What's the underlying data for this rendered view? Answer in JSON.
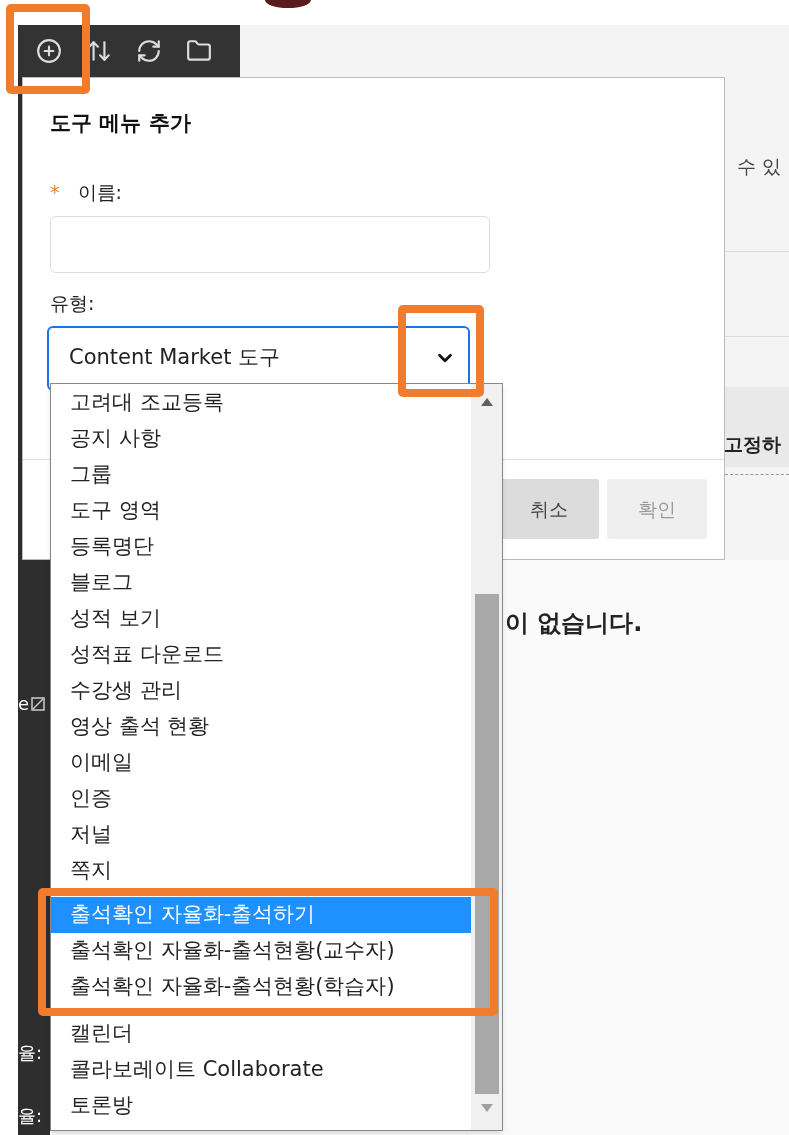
{
  "toolbar": {
    "icons": [
      {
        "kind": "add"
      },
      {
        "kind": "sort"
      },
      {
        "kind": "refresh"
      },
      {
        "kind": "folder"
      }
    ]
  },
  "background": {
    "sidebar_fragments": [
      {
        "text": "e",
        "kind": "image"
      },
      {
        "text": "율:",
        "kind": "plain"
      },
      {
        "text": "율:",
        "kind": "plain"
      }
    ],
    "right_text_1": "수 있",
    "right_text_2": "고정하",
    "message": "이 없습니다."
  },
  "dialog": {
    "title": "도구 메뉴 추가",
    "name_field": {
      "required_mark": "*",
      "label": "이름:"
    },
    "type_field": {
      "label": "유형:",
      "value": "Content Market 도구",
      "expanded": true,
      "options": [
        {
          "label": "고려대 조교등록",
          "selected": false
        },
        {
          "label": "공지 사항",
          "selected": false
        },
        {
          "label": "그룹",
          "selected": false
        },
        {
          "label": "도구 영역",
          "selected": false
        },
        {
          "label": "등록명단",
          "selected": false
        },
        {
          "label": "블로그",
          "selected": false
        },
        {
          "label": "성적 보기",
          "selected": false
        },
        {
          "label": "성적표 다운로드",
          "selected": false
        },
        {
          "label": "수강생 관리",
          "selected": false
        },
        {
          "label": "영상 출석 현황",
          "selected": false
        },
        {
          "label": "이메일",
          "selected": false
        },
        {
          "label": "인증",
          "selected": false
        },
        {
          "label": "저널",
          "selected": false
        },
        {
          "label": "쪽지",
          "selected": false
        },
        {
          "label": "출석확인 자율화-출석하기",
          "selected": true
        },
        {
          "label": "출석확인 자율화-출석현황(교수자)",
          "selected": false
        },
        {
          "label": "출석확인 자율화-출석현황(학습자)",
          "selected": false
        },
        {
          "label": "캘린더",
          "selected": false
        },
        {
          "label": "콜라보레이트 Collaborate",
          "selected": false
        },
        {
          "label": "토론방",
          "selected": false
        }
      ]
    },
    "buttons": [
      {
        "label": "취소",
        "disabled": false
      },
      {
        "label": "확인",
        "disabled": true
      }
    ]
  }
}
